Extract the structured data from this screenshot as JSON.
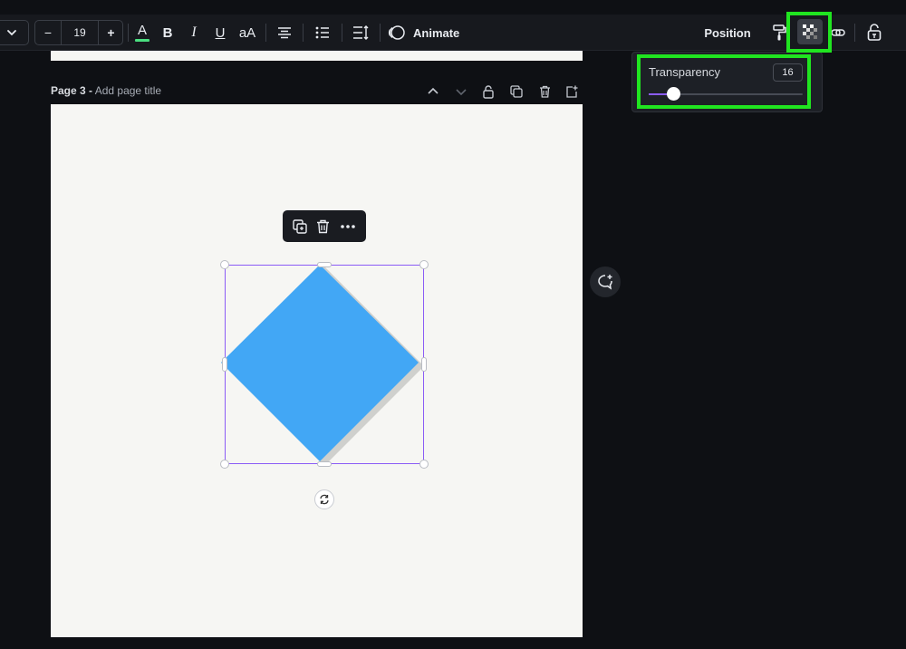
{
  "toolbar": {
    "font_size": "19",
    "minus_label": "−",
    "plus_label": "+",
    "bold_label": "B",
    "italic_label": "I",
    "underline_label": "U",
    "case_label": "aA",
    "animate_label": "Animate",
    "position_label": "Position",
    "text_color": "#4ade80"
  },
  "page": {
    "number_label": "Page 3 -",
    "title_placeholder": "Add page title",
    "background": "#f6f6f3"
  },
  "shape": {
    "fill_color": "#42a7f5",
    "shadow_color": "#cfd0cd",
    "selection_color": "#8b5cf6"
  },
  "transparency": {
    "label": "Transparency",
    "value": "16",
    "slider_fraction": 0.16
  },
  "highlight_color": "#20e520"
}
